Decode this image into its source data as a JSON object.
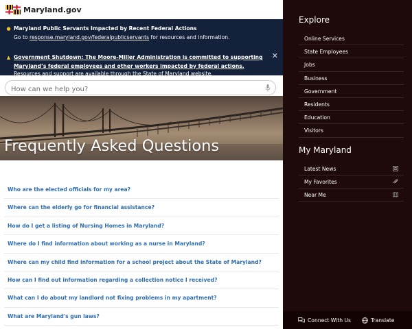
{
  "site": {
    "brand": "Maryland.gov"
  },
  "alerts": [
    {
      "title": "Maryland Public Servants Impacted by Recent Federal Actions",
      "pre": "Go to ",
      "link": "response.maryland.gov/federalpublicservants",
      "post": " for resources and information."
    },
    {
      "title_line1": "Government Shutdown: The Moore-Miller Administration is committed to supporting",
      "title_line2": "Maryland’s federal employees and other workers impacted by federal actions.",
      "line3": "Resources and support are available through the State of Maryland website.",
      "close": "✕"
    }
  ],
  "search": {
    "placeholder": "How can we help you?"
  },
  "hero": {
    "title": "Frequently Asked Questions"
  },
  "faq": [
    "Who are the elected officials for my area?",
    "Where can the elderly go for financial assistance?",
    "How do I get a listing of Nursing Homes in Maryland?",
    "Where do I find information about working as a nurse in Maryland?",
    "Where can my child find information for a school project about the State of Maryland?",
    "How can I find out information regarding a collection notice I received?",
    "What can I do about my landlord not fixing problems in my apartment?",
    "What are Maryland's gun laws?"
  ],
  "sidebar": {
    "explore_title": "Explore",
    "explore": [
      "Online Services",
      "State Employees",
      "Jobs",
      "Business",
      "Government",
      "Residents",
      "Education",
      "Visitors"
    ],
    "my_title": "My Maryland",
    "my": [
      {
        "label": "Latest News",
        "icon": "newspaper-icon"
      },
      {
        "label": "My Favorites",
        "icon": "paperclip-icon"
      },
      {
        "label": "Near Me",
        "icon": "map-icon"
      }
    ],
    "connect": "Connect With Us",
    "translate": "Translate"
  },
  "colors": {
    "alert_bg": "#14213a",
    "sidebar_bg": "#1e0a0a",
    "link": "#2e6db0",
    "warning": "#f2c12e"
  }
}
